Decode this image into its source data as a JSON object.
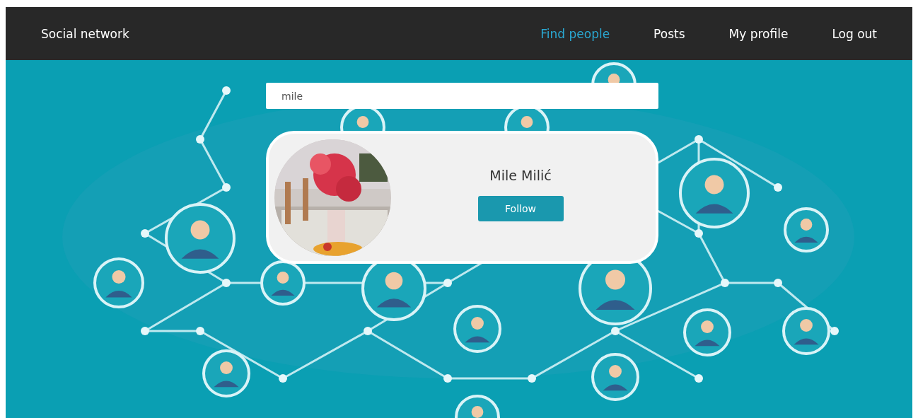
{
  "navbar": {
    "brand": "Social network",
    "items": [
      {
        "label": "Find people",
        "selected": true
      },
      {
        "label": "Posts",
        "selected": false
      },
      {
        "label": "My profile",
        "selected": false
      },
      {
        "label": "Log out",
        "selected": false
      }
    ]
  },
  "search": {
    "value": "mile"
  },
  "results": [
    {
      "name": "Mile Milić",
      "button": "Follow"
    }
  ]
}
